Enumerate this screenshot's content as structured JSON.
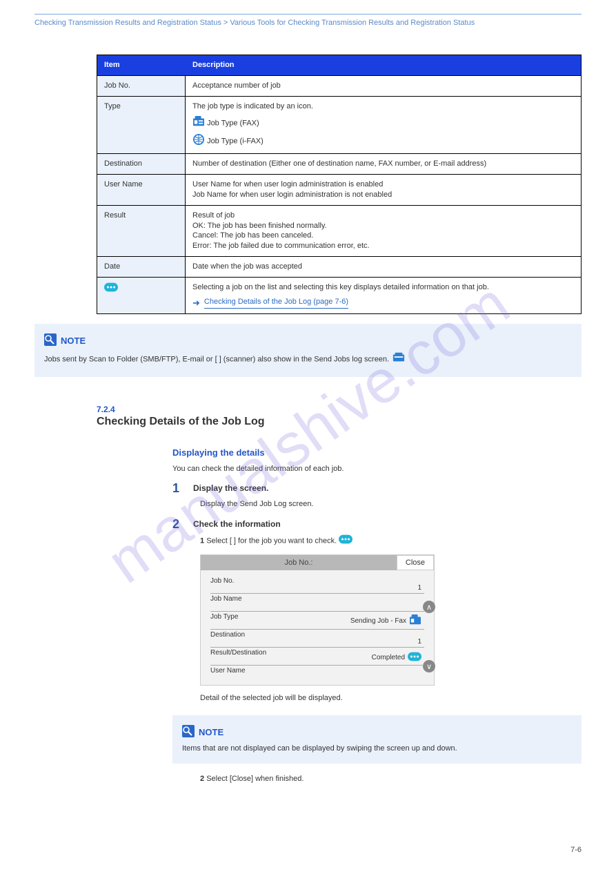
{
  "header": {
    "left": "Checking Transmission Results and Registration Status > Various Tools for Checking Transmission Results and Registration Status",
    "right": ""
  },
  "watermark": "manualshive.com",
  "table": {
    "head": {
      "item": "Item",
      "desc": "Description"
    },
    "rows": [
      {
        "l": "Job No.",
        "r": "Acceptance number of job"
      },
      {
        "l": "Type",
        "r_lines": [
          "The job type is indicated by an icon.",
          "Job Type (FAX)",
          "Job Type (i-FAX)"
        ]
      },
      {
        "l": "Destination",
        "r": "Number of destination (Either one of destination name, FAX number, or E-mail address)"
      },
      {
        "l": "User Name",
        "r_lines": [
          "User Name for when user login administration is enabled",
          "Job Name for when user login administration is not enabled"
        ]
      },
      {
        "l": "Result",
        "r_lines": [
          "Result of job",
          "OK: The job has been finished normally.",
          "Cancel: The job has been canceled.",
          "Error: The job failed due to communication error, etc."
        ]
      },
      {
        "l": "Date",
        "r": "Date when the job was accepted"
      },
      {
        "l": "",
        "r": "Selecting a job on the list and selecting this key displays detailed information on that job.",
        "link": "Checking Details of the Job Log (page 7-6)"
      }
    ]
  },
  "note1": {
    "label": "NOTE",
    "text": "Jobs sent by Scan to Folder (SMB/FTP), E-mail or [  ] (scanner) also show in the Send Jobs log screen."
  },
  "section_num": "7.2.4",
  "section_title": "Checking Details of the Job Log",
  "section_sub": "Displaying the details",
  "section_text": "You can check the detailed information of each job.",
  "step1_num": "1",
  "step1_text": "Display the screen.",
  "step1_sub": "Display the Send Job Log screen.",
  "step2_num": "2",
  "step2_text": "Check the information",
  "step2_sub_1": "Select [  ] for the job you want to check.",
  "screenshot": {
    "title": "Job No.:",
    "close": "Close",
    "lines": [
      {
        "label": "Job No.",
        "val": "1"
      },
      {
        "label": "Job Name",
        "val": ""
      },
      {
        "label": "Job Type",
        "val": "Sending Job - Fax",
        "icon": true
      },
      {
        "label": "Destination",
        "val": "1"
      },
      {
        "label": "Result/Destination",
        "val": "Completed",
        "more": true
      },
      {
        "label": "User Name",
        "val": ""
      }
    ]
  },
  "step2_sub_2": "Detail of the selected job will be displayed.",
  "note2": {
    "label": "NOTE",
    "text": "Items that are not displayed can be displayed by swiping the screen up and down."
  },
  "step2_sub_3": "Select [Close] when finished.",
  "page_num": "7-6"
}
